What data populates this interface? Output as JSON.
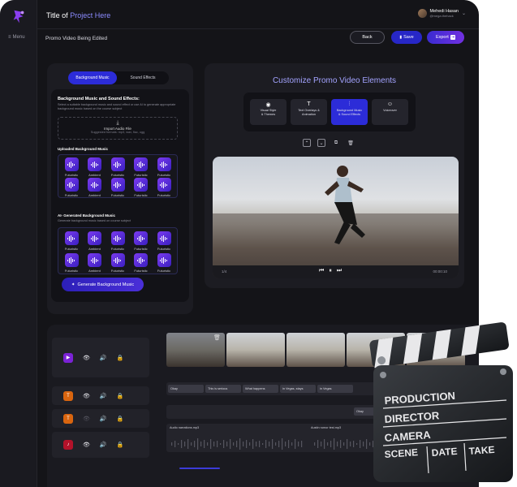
{
  "header": {
    "title_prefix": "Title of ",
    "title_highlight": "Project Here",
    "user_name": "Mehedi Hasan",
    "user_email": "@mega.thehack",
    "menu_label": "Menu"
  },
  "subheader": {
    "title": "Promo Video Being Edited",
    "back_label": "Back",
    "save_label": "Save",
    "export_label": "Export"
  },
  "music_panel": {
    "tabs": [
      "Background Music",
      "Sound Effects"
    ],
    "heading": "Background Music and Sound Effects:",
    "description": "Select a suitable background music and sound effect or use AI to generate appropriate background music based on the course subject",
    "import_title": "Import Audio File",
    "import_formats": "Suggested formats: mp3, wav, flac, ogg",
    "uploaded_heading": "Uploaded Background Music",
    "uploaded_tiles": [
      "Futuristic",
      "Ambient",
      "Futuristic",
      "Futuristic",
      "Futuristic",
      "Futuristic",
      "Ambient",
      "Futuristic",
      "Futuristic",
      "Futuristic"
    ],
    "ai_heading": "AI- Generated Background Music",
    "ai_description": "Generate background music based on course subject",
    "ai_tiles": [
      "Futuristic",
      "Ambient",
      "Futuristic",
      "Futuristic",
      "Futuristic",
      "Futuristic",
      "Ambient",
      "Futuristic",
      "Futuristic",
      "Futuristic"
    ],
    "generate_label": "Generate Background Music"
  },
  "customize": {
    "title_a": "Customize Promo",
    "title_b": " Video Elements",
    "options": [
      {
        "label_1": "Visual Style",
        "label_2": "& Themes",
        "icon": "eye-icon"
      },
      {
        "label_1": "Text Overlays &",
        "label_2": "Animation",
        "icon": "text-icon"
      },
      {
        "label_1": "Background Music",
        "label_2": "& Sound Effects",
        "icon": "music-wave-icon"
      },
      {
        "label_1": "Voiceover",
        "label_2": "",
        "icon": "voiceover-icon"
      }
    ],
    "video": {
      "current": "1/4",
      "duration": "00:00:10"
    }
  },
  "timeline": {
    "captions": [
      "Okay",
      "This is serious",
      "What happens",
      "in Vegas, stays",
      "in Vegas"
    ],
    "row2_caption": "Okay",
    "audio_1": "Audio narrations.mp3",
    "audio_2": "Austin rumor test.mp3"
  },
  "clapperboard": {
    "lines": [
      "PRODUCTION",
      "DIRECTOR",
      "CAMERA"
    ],
    "bottom": [
      "SCENE",
      "DATE",
      "TAKE"
    ]
  },
  "colors": {
    "accent": "#2c2cd8",
    "accent_light": "#a3a3ff",
    "tile": "#7b3bf0",
    "track_video": "#7b22d6",
    "track_text": "#d9650f",
    "track_audio": "#b3122a"
  }
}
